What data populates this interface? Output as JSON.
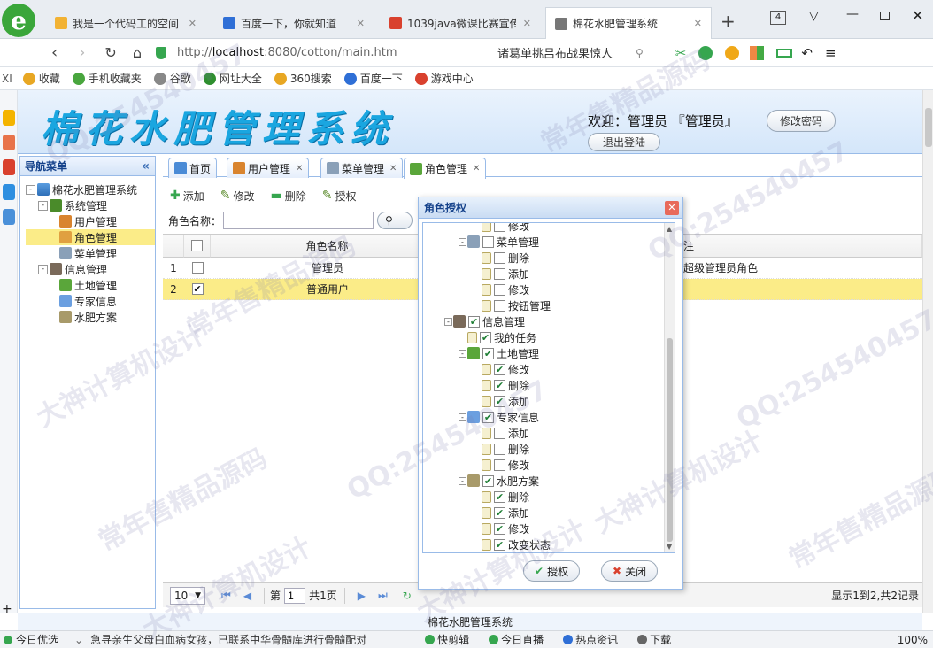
{
  "browser": {
    "tabs": [
      {
        "label": "我是一个代码工的空间 [i",
        "color": "#f2b233"
      },
      {
        "label": "百度一下，你就知道",
        "color": "#2f6fd6"
      },
      {
        "label": "1039java微课比赛宣传网",
        "color": "#d9412e"
      },
      {
        "label": "棉花水肥管理系统",
        "color": "#777777"
      }
    ],
    "tab_count": "4",
    "url_prefix": "http://",
    "url_host": "localhost",
    "url_rest": ":8080/cotton/main.htm",
    "news_text": "诸葛单挑吕布战果惊人",
    "bookmarks": [
      "收藏",
      "手机收藏夹",
      "谷歌",
      "网址大全",
      "360搜索",
      "百度一下",
      "游戏中心"
    ],
    "bookmark_colors": [
      "#e8a723",
      "#49a63e",
      "#888888",
      "#2f8f2f",
      "#e8a723",
      "#2f6fd6",
      "#d9412e"
    ],
    "bookmark_prefix": "XI"
  },
  "app": {
    "title": "棉花水肥管理系统",
    "welcome": "欢迎：管理员 『管理员』",
    "change_password": "修改密码",
    "logout": "退出登陆",
    "footer": "棉花水肥管理系统"
  },
  "nav": {
    "header": "导航菜单",
    "collapse": "«",
    "root": "棉花水肥管理系统",
    "items": [
      {
        "label": "系统管理",
        "level": 1,
        "toggle": "-"
      },
      {
        "label": "用户管理",
        "level": 2
      },
      {
        "label": "角色管理",
        "level": 2,
        "selected": true
      },
      {
        "label": "菜单管理",
        "level": 2
      },
      {
        "label": "信息管理",
        "level": 1,
        "toggle": "-"
      },
      {
        "label": "土地管理",
        "level": 2
      },
      {
        "label": "专家信息",
        "level": 2
      },
      {
        "label": "水肥方案",
        "level": 2
      }
    ]
  },
  "tabs": [
    "首页",
    "用户管理",
    "菜单管理",
    "角色管理"
  ],
  "toolbar": [
    "添加",
    "修改",
    "删除",
    "授权"
  ],
  "search": {
    "label": "角色名称：",
    "value": ""
  },
  "grid": {
    "columns": [
      "角色名称",
      "注"
    ],
    "rows": [
      {
        "num": "1",
        "checked": false,
        "name": "管理员",
        "remark": "超级管理员角色"
      },
      {
        "num": "2",
        "checked": true,
        "name": "普通用户",
        "remark": ""
      }
    ]
  },
  "pager": {
    "page_size": "10",
    "page_prefix": "第",
    "page": "1",
    "total_pages": "共1页",
    "summary": "显示1到2,共2记录"
  },
  "dialog": {
    "title": "角色授权",
    "grant": "授权",
    "close": "关闭",
    "tree": [
      {
        "label": "修改",
        "depth": 3,
        "checked": false
      },
      {
        "label": "菜单管理",
        "depth": 2,
        "checked": false,
        "folder": true
      },
      {
        "label": "删除",
        "depth": 3,
        "checked": false
      },
      {
        "label": "添加",
        "depth": 3,
        "checked": false
      },
      {
        "label": "修改",
        "depth": 3,
        "checked": false
      },
      {
        "label": "按钮管理",
        "depth": 3,
        "checked": false
      },
      {
        "label": "信息管理",
        "depth": 1,
        "checked": true,
        "folder": true
      },
      {
        "label": "我的任务",
        "depth": 2,
        "checked": true
      },
      {
        "label": "土地管理",
        "depth": 2,
        "checked": true,
        "folder": true
      },
      {
        "label": "修改",
        "depth": 3,
        "checked": true
      },
      {
        "label": "删除",
        "depth": 3,
        "checked": true
      },
      {
        "label": "添加",
        "depth": 3,
        "checked": true
      },
      {
        "label": "专家信息",
        "depth": 2,
        "checked": true,
        "folder": true
      },
      {
        "label": "添加",
        "depth": 3,
        "checked": false
      },
      {
        "label": "删除",
        "depth": 3,
        "checked": false
      },
      {
        "label": "修改",
        "depth": 3,
        "checked": false
      },
      {
        "label": "水肥方案",
        "depth": 2,
        "checked": true,
        "folder": true
      },
      {
        "label": "删除",
        "depth": 3,
        "checked": true
      },
      {
        "label": "添加",
        "depth": 3,
        "checked": true
      },
      {
        "label": "修改",
        "depth": 3,
        "checked": true
      },
      {
        "label": "改变状态",
        "depth": 3,
        "checked": true
      }
    ]
  },
  "statusbar": {
    "left": "今日优选",
    "news": "急寻亲生父母白血病女孩，已联系中华骨髓库进行骨髓配对",
    "items": [
      "快剪辑",
      "今日直播",
      "热点资讯",
      "下载"
    ],
    "zoom": "100%"
  },
  "watermarks": [
    "QQ:254540457",
    "常年售精品源码",
    "大神计算机设计"
  ],
  "colors": {
    "accent": "#1aa6e0",
    "border": "#99bbe8",
    "selected_row": "#fbec88",
    "check": "#1e7e34"
  }
}
